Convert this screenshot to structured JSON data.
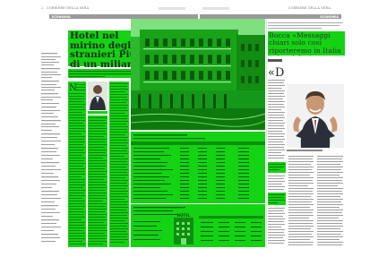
{
  "page": {
    "page_number": "2",
    "newspaper_left": "CORRIERE DELLA SERA",
    "newspaper_right": "CORRIERE DELLA SERA",
    "section_left": "ECONOMIA",
    "section_right": "ECONOMIA",
    "left_headline": "Hotel nel mirino degli stranieri Più di un miliardo di investimenti",
    "right_headline": "Bocca «Messaggi chiari solo così riporteremo in Italia i viaggiatori americani»",
    "big_quote_mark": "«D",
    "hotel_sign": "HOTEL"
  },
  "colors": {
    "highlight": "#13d313",
    "highlight_dark": "#0c8f0c",
    "bar": "#9a9a9a"
  },
  "chart_data": {
    "type": "table",
    "title": "",
    "columns": [],
    "rows": []
  }
}
